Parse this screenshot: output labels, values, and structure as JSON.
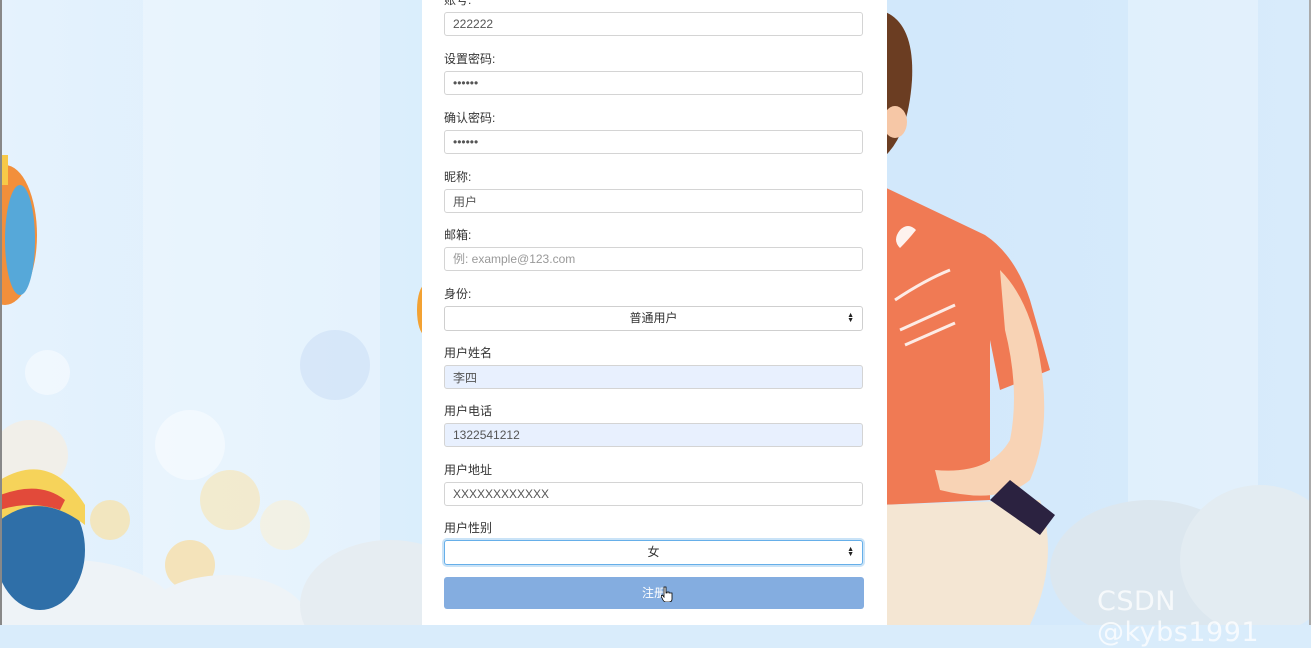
{
  "form": {
    "account": {
      "label": "账号:",
      "value": "222222"
    },
    "password": {
      "label": "设置密码:",
      "value": "••••••"
    },
    "confirm_password": {
      "label": "确认密码:",
      "value": "••••••"
    },
    "nickname": {
      "label": "昵称:",
      "value": "用户"
    },
    "email": {
      "label": "邮箱:",
      "placeholder": "例: example@123.com"
    },
    "identity": {
      "label": "身份:",
      "selected": "普通用户"
    },
    "real_name": {
      "label": "用户姓名",
      "value": "李四"
    },
    "phone": {
      "label": "用户电话",
      "value": "1322541212"
    },
    "address": {
      "label": "用户地址",
      "value": "XXXXXXXXXXXX"
    },
    "gender": {
      "label": "用户性别",
      "selected": "女"
    },
    "register_button": "注册"
  },
  "watermark": "CSDN @kybs1991",
  "colors": {
    "button": "#84ade0",
    "autofill": "#e8f0fe",
    "focus": "#66afe9",
    "shirt": "#f07a54"
  }
}
